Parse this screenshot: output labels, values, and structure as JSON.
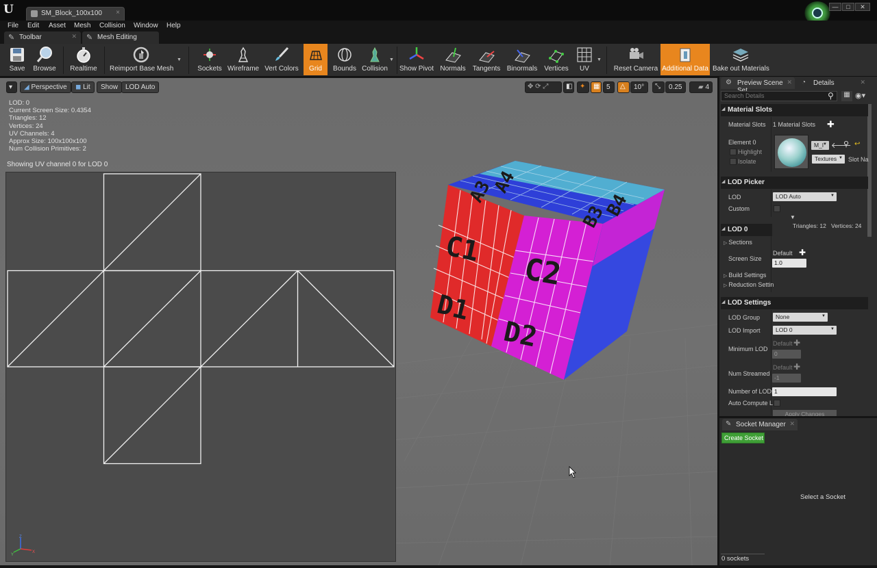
{
  "window": {
    "tab_title": "SM_Block_100x100",
    "close": "×",
    "min": "—",
    "max": "□",
    "winclose": "✕"
  },
  "menu": [
    "File",
    "Edit",
    "Asset",
    "Mesh",
    "Collision",
    "Window",
    "Help"
  ],
  "panel_tabs": [
    "Toolbar",
    "Mesh Editing"
  ],
  "toolbar": {
    "save": "Save",
    "browse": "Browse",
    "realtime": "Realtime",
    "reimport": "Reimport Base Mesh",
    "sockets": "Sockets",
    "wireframe": "Wireframe",
    "vert_colors": "Vert Colors",
    "grid": "Grid",
    "bounds": "Bounds",
    "collision": "Collision",
    "show_pivot": "Show Pivot",
    "normals": "Normals",
    "tangents": "Tangents",
    "binormals": "Binormals",
    "vertices": "Vertices",
    "uv": "UV",
    "reset_camera": "Reset Camera",
    "additional_data": "Additional Data",
    "bake_out": "Bake out Materials"
  },
  "viewport": {
    "perspective": "Perspective",
    "lit": "Lit",
    "show": "Show",
    "lod_auto": "LOD Auto",
    "grid_size": "5",
    "rot_snap": "10°",
    "scale_snap": "0.25",
    "cam_speed": "4",
    "stats": [
      "LOD:  0",
      "Current Screen Size:  0.4354",
      "Triangles:  12",
      "Vertices:  24",
      "UV Channels:  4",
      "Approx Size:  100x100x100",
      "Num Collision Primitives:  2"
    ],
    "uv_note": "Showing UV channel 0 for LOD 0",
    "cube_labels": [
      "A3",
      "A4",
      "B3",
      "B4",
      "C1",
      "C2",
      "D1",
      "D2"
    ]
  },
  "details": {
    "tab_scene": "Preview Scene Set",
    "tab_details": "Details",
    "search_placeholder": "Search Details",
    "material_slots_header": "Material Slots",
    "material_slots_label": "Material Slots",
    "material_slots_value": "1 Material Slots",
    "element0": "Element 0",
    "highlight": "Highlight",
    "isolate": "Isolate",
    "mat_combo": "M_I",
    "textures": "Textures",
    "slot_name": "Slot Na",
    "lod_picker_header": "LOD Picker",
    "lod_label": "LOD",
    "lod_value": "LOD Auto",
    "custom": "Custom",
    "triangles": "Triangles: 12",
    "vertices": "Vertices: 24",
    "lod0_header": "LOD 0",
    "sections": "Sections",
    "screen_size": "Screen Size",
    "default1": "Default",
    "screen_size_val": "1.0",
    "build_settings": "Build Settings",
    "reduction_settings": "Reduction Settin",
    "lod_settings_header": "LOD Settings",
    "lod_group": "LOD Group",
    "lod_group_val": "None",
    "lod_import": "LOD Import",
    "lod_import_val": "LOD 0",
    "min_lod": "Minimum LOD",
    "default2": "Default",
    "min_lod_val": "0",
    "num_streamed": "Num Streamed",
    "default3": "Default",
    "num_streamed_val": "-1",
    "num_lods": "Number of LODs",
    "num_lods_val": "1",
    "auto_compute": "Auto Compute L",
    "apply_changes": "Apply Changes"
  },
  "sockets": {
    "tab": "Socket Manager",
    "create": "Create Socket",
    "select": "Select a Socket",
    "count": "0 sockets"
  },
  "colors": {
    "accent": "#e8861e",
    "create_socket": "#3f9f36",
    "panel": "#2d2d2d"
  }
}
